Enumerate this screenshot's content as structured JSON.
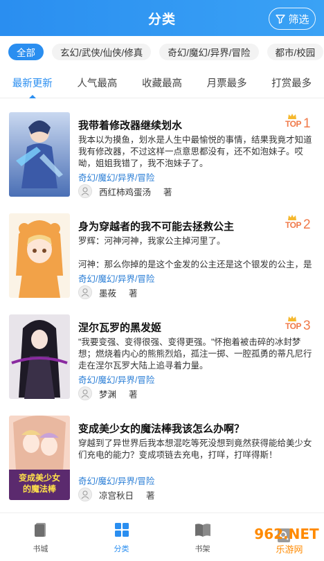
{
  "header": {
    "title": "分类",
    "filter_label": "筛选"
  },
  "genres": [
    {
      "label": "全部",
      "active": true
    },
    {
      "label": "玄幻/武侠/仙侠/修真",
      "active": false
    },
    {
      "label": "奇幻/魔幻/异界/冒险",
      "active": false
    },
    {
      "label": "都市/校园",
      "active": false
    }
  ],
  "sorts": [
    {
      "label": "最新更新",
      "active": true
    },
    {
      "label": "人气最高",
      "active": false
    },
    {
      "label": "收藏最高",
      "active": false
    },
    {
      "label": "月票最多",
      "active": false
    },
    {
      "label": "打赏最多",
      "active": false
    }
  ],
  "books": [
    {
      "title": "我带着修改器继续划水",
      "desc": "我本以为摸鱼，划水是人生中最愉悦的事情，结果我竟才知道我有修改器，不过这样一点意思都没有，还不如泡妹子。哎呦，姐姐我错了，我不泡妹子了。",
      "tags": "奇幻/魔幻/异界/冒险",
      "author": "西红柿鸡蛋汤",
      "author_suffix": "著",
      "rank_label": "TOP",
      "rank": "1"
    },
    {
      "title": "身为穿越者的我不可能去拯救公主",
      "desc": "罗辉：河神河神，我家公主掉河里了。\n\n河神：那么你掉的是这个金发的公主还是这个银发的公主，是",
      "tags": "奇幻/魔幻/异界/冒险",
      "author": "墨莜",
      "author_suffix": "著",
      "rank_label": "TOP",
      "rank": "2"
    },
    {
      "title": "涅尔瓦罗的黑发姬",
      "desc": "\"我要变强、变得很强、变得更强。\"怀抱着被击碎的冰封梦想；燃烧着内心的熊熊烈焰，孤注一掷、一腔孤勇的蒂凡尼行走在涅尔瓦罗大陆上追寻着力量。",
      "tags": "奇幻/魔幻/异界/冒险",
      "author": "梦渊",
      "author_suffix": "著",
      "rank_label": "TOP",
      "rank": "3"
    },
    {
      "title": "变成美少女的魔法棒我该怎么办啊？",
      "desc": "穿越到了异世界后我本想混吃等死没想到竟然获得能给美少女们充电的能力？变成项链去充电，打咩，打咩得斯！",
      "tags": "奇幻/魔幻/异界/冒险",
      "author": "凉宫秋日",
      "author_suffix": "著",
      "cover_text_1": "变成美少女",
      "cover_text_2": "的魔法棒"
    }
  ],
  "bottom_nav": [
    {
      "label": "书城",
      "icon": "book-icon",
      "active": false
    },
    {
      "label": "分类",
      "icon": "grid-icon",
      "active": true
    },
    {
      "label": "书架",
      "icon": "open-book-icon",
      "active": false
    },
    {
      "label": "",
      "icon": "search-icon",
      "active": false
    }
  ],
  "watermark": {
    "text": "962.NET",
    "sub": "乐游网"
  },
  "colors": {
    "accent": "#2a8ef0",
    "rank": "#f07a4a",
    "tag": "#2a7ed6"
  }
}
